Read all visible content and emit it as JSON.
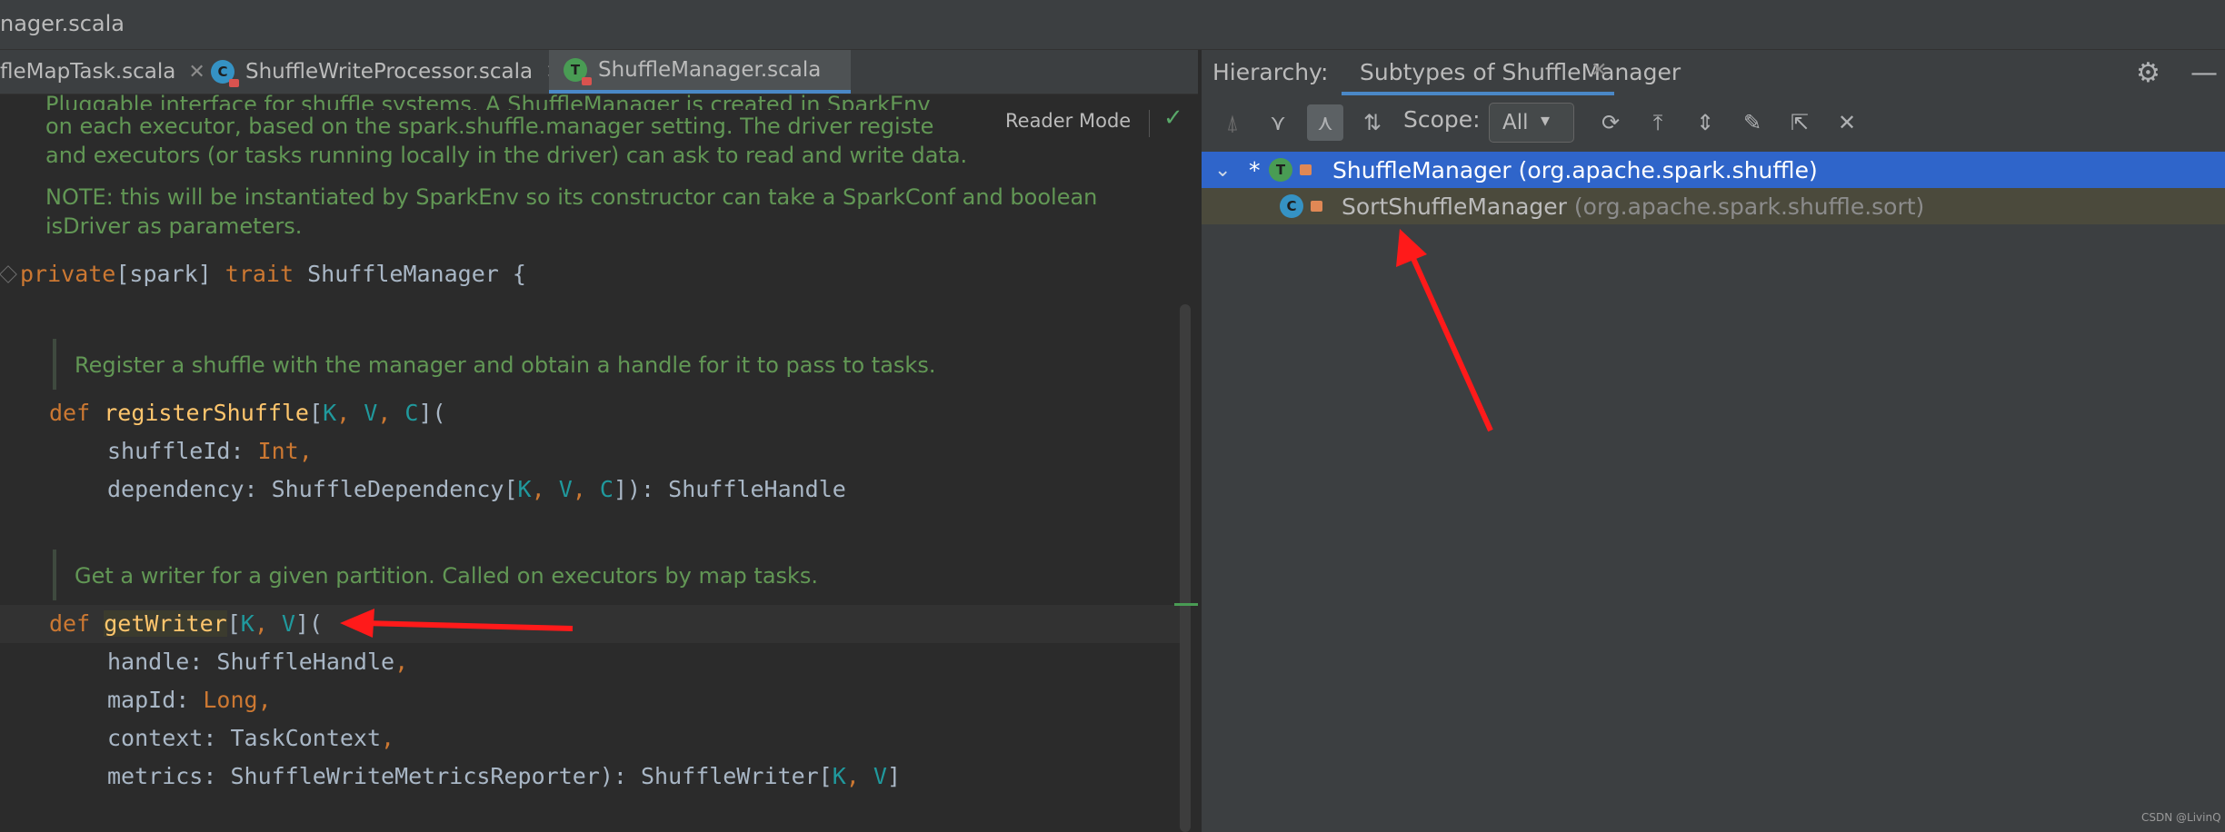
{
  "window": {
    "title": "nager.scala"
  },
  "editor": {
    "tabs": [
      {
        "label": "fleMapTask.scala",
        "icon": "scala-file-icon"
      },
      {
        "label": "ShuffleWriteProcessor.scala",
        "icon": "class-icon"
      },
      {
        "label": "ShuffleManager.scala",
        "icon": "trait-icon"
      }
    ],
    "reader_mode": "Reader Mode",
    "doc": {
      "line1": "Pluggable interface for shuffle systems. A ShuffleManager is created in SparkEnv",
      "line2": "on each executor, based on the spark.shuffle.manager setting. The driver registe",
      "line3": "and executors (or tasks running locally in the driver) can ask to read and write data.",
      "note1": "NOTE: this will be instantiated by SparkEnv so its constructor can take a SparkConf and boolean",
      "note2": "isDriver as parameters.",
      "register": "Register a shuffle with the manager and obtain a handle for it to pass to tasks.",
      "writer": "Get a writer for a given partition. Called on executors by map tasks."
    },
    "code": {
      "t_private": "private",
      "t_spark": "[spark] ",
      "t_trait": "trait",
      "t_name": " ShuffleManager {",
      "def": "def",
      "registerShuffle": "registerShuffle",
      "shuffleId": "shuffleId: ",
      "int": "Int",
      "comma": ",",
      "dependency": "dependency: ShuffleDependency[",
      "dep_close": "]): ShuffleHandle",
      "getWriter": "getWriter",
      "handle": "handle: ShuffleHandle",
      "mapId": "mapId: ",
      "long": "Long",
      "context": "context: TaskContext",
      "metrics": "metrics: ShuffleWriteMetricsReporter): ShuffleWriter[",
      "K": "K",
      "V": "V",
      "C": "C",
      "lbr": "[",
      "sep": ", ",
      "rbr_paren": "](",
      "rbr": "]"
    }
  },
  "hierarchy": {
    "title": "Hierarchy:",
    "tab": "Subtypes of ShuffleManager",
    "scope_label": "Scope:",
    "scope_value": "All",
    "tree": [
      {
        "star": "*",
        "name": "ShuffleManager (org.apache.spark.shuffle)",
        "selected": true
      },
      {
        "name": "SortShuffleManager",
        "pkg": "(org.apache.spark.shuffle.sort)"
      }
    ]
  },
  "watermark": "CSDN @LivinQ",
  "colors": {
    "selection": "#2f65ca",
    "keyword": "#cc7832",
    "function": "#ffc66d",
    "doc": "#629755",
    "annotation_arrow": "#ff1a1a"
  }
}
